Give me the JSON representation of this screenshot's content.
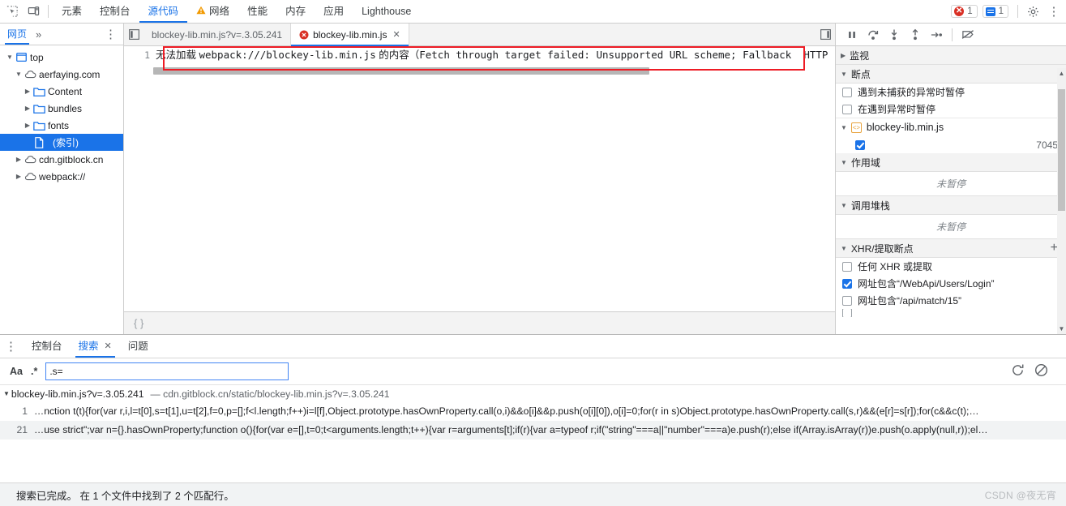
{
  "main_toolbar": {
    "inspect_icon": "inspect-cursor-icon",
    "device_icon": "device-toolbar-icon",
    "tabs": [
      {
        "label": "元素",
        "active": false,
        "warn": false
      },
      {
        "label": "控制台",
        "active": false,
        "warn": false
      },
      {
        "label": "源代码",
        "active": true,
        "warn": false
      },
      {
        "label": "网络",
        "active": false,
        "warn": true
      },
      {
        "label": "性能",
        "active": false,
        "warn": false
      },
      {
        "label": "内存",
        "active": false,
        "warn": false
      },
      {
        "label": "应用",
        "active": false,
        "warn": false
      },
      {
        "label": "Lighthouse",
        "active": false,
        "warn": false
      }
    ],
    "error_count": "1",
    "message_count": "1",
    "settings_icon": "gear-icon",
    "more_icon": "kebab-menu-icon",
    "accent": "#1a73e8",
    "error_color": "#d93025"
  },
  "navigator": {
    "tab_label": "网页",
    "more_label": "»",
    "menu_icon": "kebab-menu-icon",
    "tree": [
      {
        "label": "top",
        "indent": 0,
        "icon": "frame-icon",
        "twisty": "▼",
        "selected": false
      },
      {
        "label": "aerfaying.com",
        "indent": 1,
        "icon": "cloud-icon",
        "twisty": "▼",
        "selected": false
      },
      {
        "label": "Content",
        "indent": 2,
        "icon": "folder-icon",
        "twisty": "▶",
        "selected": false
      },
      {
        "label": "bundles",
        "indent": 2,
        "icon": "folder-icon",
        "twisty": "▶",
        "selected": false
      },
      {
        "label": "fonts",
        "indent": 2,
        "icon": "folder-icon",
        "twisty": "▶",
        "selected": false
      },
      {
        "label": "(索引)",
        "indent": 3,
        "icon": "document-icon",
        "twisty": "",
        "selected": true
      },
      {
        "label": "cdn.gitblock.cn",
        "indent": 1,
        "icon": "cloud-icon",
        "twisty": "▶",
        "selected": false
      },
      {
        "label": "webpack://",
        "indent": 1,
        "icon": "cloud-icon",
        "twisty": "▶",
        "selected": false
      }
    ]
  },
  "editor": {
    "collapse_left_icon": "panel-collapse-left-icon",
    "collapse_right_icon": "panel-expand-right-icon",
    "tabs": [
      {
        "label": "blockey-lib.min.js?v=.3.05.241",
        "active": false,
        "error": false,
        "closable": false
      },
      {
        "label": "blockey-lib.min.js",
        "active": true,
        "error": true,
        "closable": true
      }
    ],
    "close_label": "✕",
    "line_number": "1",
    "content_cn": "无法加载 ",
    "content_mono_1": "webpack:///blockey-lib.min.js",
    "content_cn_2": " 的内容（",
    "content_mono_2": "Fetch through target failed: Unsupported URL scheme; Fallback",
    "content_mono_3": "HTTP",
    "format_label": "{ }",
    "highlight_color": "#ee1c25"
  },
  "debugger": {
    "toolbar": [
      {
        "icon": "pause-resume-icon",
        "name": "resume-script-button"
      },
      {
        "icon": "step-over-icon",
        "name": "step-over-button"
      },
      {
        "icon": "step-into-icon",
        "name": "step-into-button"
      },
      {
        "icon": "step-out-icon",
        "name": "step-out-button"
      },
      {
        "icon": "step-icon",
        "name": "step-button"
      },
      {
        "icon": "deactivate-breakpoints-icon",
        "name": "deactivate-breakpoints-button"
      }
    ],
    "sections": {
      "watch": {
        "title": "监视",
        "arrow": "▶"
      },
      "breakpoints": {
        "title": "断点",
        "arrow": "▼",
        "pause_uncaught": "遇到未捕获的异常时暂停",
        "pause_exceptions": "在遇到异常时暂停",
        "pause_uncaught_checked": false,
        "pause_exceptions_checked": false,
        "file": "blockey-lib.min.js",
        "file_arrow": "▼",
        "file_badge": "<>",
        "entry_checked": true,
        "entry_line": "7045"
      },
      "scope": {
        "title": "作用域",
        "arrow": "▼",
        "empty": "未暂停"
      },
      "callstack": {
        "title": "调用堆栈",
        "arrow": "▼",
        "empty": "未暂停"
      },
      "xhr": {
        "title": "XHR/提取断点",
        "arrow": "▼",
        "add_label": "+",
        "items": [
          {
            "label": "任何 XHR 或提取",
            "checked": false
          },
          {
            "label": "网址包含“/WebApi/Users/Login”",
            "checked": true
          },
          {
            "label": "网址包含“/api/match/15”",
            "checked": false
          }
        ]
      }
    }
  },
  "drawer": {
    "menu_icon": "kebab-menu-icon",
    "tabs": [
      {
        "label": "控制台",
        "active": false,
        "closable": false
      },
      {
        "label": "搜索",
        "active": true,
        "closable": true
      },
      {
        "label": "问题",
        "active": false,
        "closable": false
      }
    ],
    "close_label": "✕",
    "match_case_label": "Aa",
    "regex_label": ".*",
    "search_value": ".s=",
    "search_placeholder": "",
    "refresh_icon": "refresh-icon",
    "clear_icon": "clear-icon",
    "results": {
      "file_arrow": "▼",
      "file_name": "blockey-lib.min.js?v=.3.05.241",
      "file_url": "— cdn.gitblock.cn/static/blockey-lib.min.js?v=.3.05.241",
      "lines": [
        {
          "number": "1",
          "text": "…nction t(t){for(var r,i,l=t[0],s=t[1],u=t[2],f=0,p=[];f<l.length;f++)i=l[f],Object.prototype.hasOwnProperty.call(o,i)&&o[i]&&p.push(o[i][0]),o[i]=0;for(r in s)Object.prototype.hasOwnProperty.call(s,r)&&(e[r]=s[r]);for(c&&c(t);…"
        },
        {
          "number": "21",
          "text": "…use strict\";var n={}.hasOwnProperty;function o(){for(var e=[],t=0;t<arguments.length;t++){var r=arguments[t];if(r){var a=typeof r;if(\"string\"===a||\"number\"===a)e.push(r);else if(Array.isArray(r))e.push(o.apply(null,r));el…"
        }
      ]
    },
    "status": "搜索已完成。  在 1 个文件中找到了 2 个匹配行。"
  },
  "watermark": "CSDN @夜无宵"
}
